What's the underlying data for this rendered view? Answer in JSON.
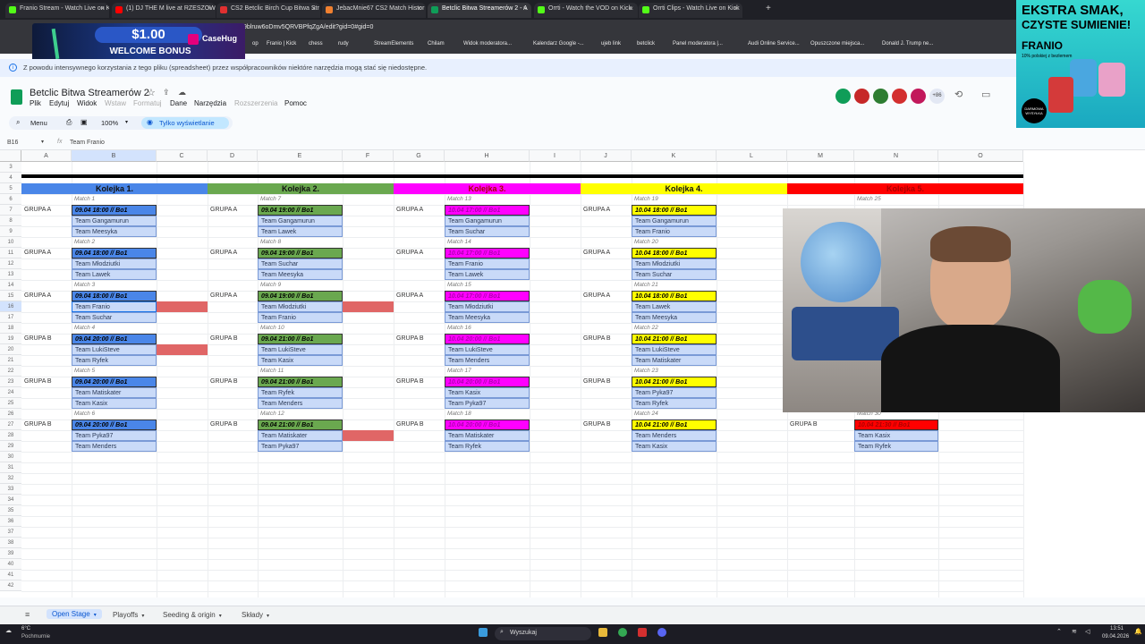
{
  "browser": {
    "tabs": [
      {
        "label": "Franio Stream - Watch Live on K",
        "fav": "#53fc18"
      },
      {
        "label": "(1) DJ THE M live at RZESZOW",
        "fav": "#ff0000"
      },
      {
        "label": "CS2 Betclic Birch Cup Bitwa Str",
        "fav": "#e03030"
      },
      {
        "label": "JebacMnie67 CS2 Match Histor",
        "fav": "#f08030"
      },
      {
        "label": "Betclic Bitwa Streamerów 2 - A",
        "fav": "#0f9d58"
      },
      {
        "label": "Orrti - Watch the VOD on Kick",
        "fav": "#53fc18"
      },
      {
        "label": "Orrti Clips - Watch Live on Kick",
        "fav": "#53fc18"
      }
    ],
    "address": "9blruw6oDmv5QRVBPfqZgA/edit?gid=0#gid=0",
    "bookmarks": [
      "op",
      "Franio | Kick",
      "chess",
      "rudy",
      "StreamElements",
      "Chilam",
      "Widok moderatora...",
      "Kalendarz Google -...",
      "ujeb link",
      "betclick",
      "Panel moderatora |...",
      "Audi Online Service...",
      "Opuszczone miejsca...",
      "Donald J. Trump ne..."
    ]
  },
  "ads": {
    "top_amount": "$1.00",
    "top_bonus": "WELCOME BONUS",
    "top_brand": "CaseHug",
    "right_line1": "EKSTRA SMAK,",
    "right_line2": "CZYSTE SUMIENIE!",
    "right_brand": "FRANIO",
    "right_small": "10% polskiej z bezlemem",
    "right_badge": "DARMOWA WYSYŁKA"
  },
  "banner": {
    "text": "Z powodu intensywnego korzystania z tego pliku (spreadsheet) przez współpracowników niektóre narzędzia mogą stać się niedostępne."
  },
  "doc": {
    "title": "Betclic Bitwa Streamerów 2",
    "menu": [
      "Plik",
      "Edytuj",
      "Widok",
      "Wstaw",
      "Formatuj",
      "Dane",
      "Narzędzia",
      "Rozszerzenia",
      "Pomoc"
    ],
    "toolbar": {
      "menu_label": "Menu",
      "zoom": "100%",
      "view_only": "Tylko wyświetlanie"
    },
    "collab_count": "+86",
    "name_box": "B16",
    "formula": "Team Franio"
  },
  "grid": {
    "columns": [
      "A",
      "B",
      "C",
      "D",
      "E",
      "F",
      "G",
      "H",
      "I",
      "J",
      "K",
      "L",
      "M",
      "N",
      "O"
    ],
    "rows": [
      "3",
      "4",
      "5",
      "6",
      "7",
      "8",
      "9",
      "10",
      "11",
      "12",
      "13",
      "14",
      "15",
      "16",
      "17",
      "18",
      "19",
      "20",
      "21",
      "22",
      "23",
      "24",
      "25",
      "26",
      "27",
      "28",
      "29",
      "30",
      "31",
      "32",
      "33",
      "34",
      "35",
      "36",
      "37",
      "38",
      "39",
      "40",
      "41",
      "42"
    ],
    "rounds": [
      {
        "label": "Kolejka 1.",
        "color": "#4a86e8"
      },
      {
        "label": "Kolejka 2.",
        "color": "#6aa84f"
      },
      {
        "label": "Kolejka 3.",
        "color": "#ff00ff"
      },
      {
        "label": "Kolejka 4.",
        "color": "#ffff00"
      },
      {
        "label": "Kolejka 5.",
        "color": "#ff0000"
      }
    ],
    "groups": [
      "GRUPA A",
      "GRUPA A",
      "GRUPA A",
      "GRUPA B",
      "GRUPA B",
      "GRUPA B"
    ],
    "round1": [
      {
        "match": "Match 1",
        "time": "09.04 18:00  // Bo1",
        "t1": "Team Gangamurun",
        "t2": "Team Meesyka"
      },
      {
        "match": "Match 2",
        "time": "09.04 18:00  // Bo1",
        "t1": "Team Młodziutki",
        "t2": "Team Lawek"
      },
      {
        "match": "Match 3",
        "time": "09.04 18:00  // Bo1",
        "t1": "Team Franio",
        "t2": "Team Suchar"
      },
      {
        "match": "Match 4",
        "time": "09.04 20:00  // Bo1",
        "t1": "Team LukiSteve",
        "t2": "Team Ryfek"
      },
      {
        "match": "Match 5",
        "time": "09.04 20:00  // Bo1",
        "t1": "Team Matiskater",
        "t2": "Team Kasix"
      },
      {
        "match": "Match 6",
        "time": "09.04 20:00  // Bo1",
        "t1": "Team Pyka97",
        "t2": "Team Menders"
      }
    ],
    "round2": [
      {
        "match": "Match 7",
        "time": "09.04 19:00  // Bo1",
        "t1": "Team Gangamurun",
        "t2": "Team Lawek"
      },
      {
        "match": "Match 8",
        "time": "09.04 19:00  // Bo1",
        "t1": "Team Suchar",
        "t2": "Team Meesyka"
      },
      {
        "match": "Match 9",
        "time": "09.04 19:00  // Bo1",
        "t1": "Team Młodziutki",
        "t2": "Team Franio"
      },
      {
        "match": "Match 10",
        "time": "09.04 21:00  // Bo1",
        "t1": "Team LukiSteve",
        "t2": "Team Kasix"
      },
      {
        "match": "Match 11",
        "time": "09.04 21:00  // Bo1",
        "t1": "Team Ryfek",
        "t2": "Team Menders"
      },
      {
        "match": "Match 12",
        "time": "09.04 21:00  // Bo1",
        "t1": "Team Matiskater",
        "t2": "Team Pyka97"
      }
    ],
    "round3": [
      {
        "match": "Match 13",
        "time": "10.04 17:00  // Bo1",
        "t1": "Team Gangamurun",
        "t2": "Team Suchar"
      },
      {
        "match": "Match 14",
        "time": "10.04 17:00  // Bo1",
        "t1": "Team Franio",
        "t2": "Team Lawek"
      },
      {
        "match": "Match 15",
        "time": "10.04 17:00  // Bo1",
        "t1": "Team Młodziutki",
        "t2": "Team Meesyka"
      },
      {
        "match": "Match 16",
        "time": "10.04 20:00  // Bo1",
        "t1": "Team LukiSteve",
        "t2": "Team Menders"
      },
      {
        "match": "Match 17",
        "time": "10.04 20:00  // Bo1",
        "t1": "Team Kasix",
        "t2": "Team Pyka97"
      },
      {
        "match": "Match 18",
        "time": "10.04 20:00  // Bo1",
        "t1": "Team Matiskater",
        "t2": "Team Ryfek"
      }
    ],
    "round4": [
      {
        "match": "Match 19",
        "time": "10.04 18:00  // Bo1",
        "t1": "Team Gangamurun",
        "t2": "Team Franio"
      },
      {
        "match": "Match 20",
        "time": "10.04 18:00  // Bo1",
        "t1": "Team Młodziutki",
        "t2": "Team Suchar"
      },
      {
        "match": "Match 21",
        "time": "10.04 18:00  // Bo1",
        "t1": "Team Lawek",
        "t2": "Team Meesyka"
      },
      {
        "match": "Match 22",
        "time": "10.04 21:00  // Bo1",
        "t1": "Team LukiSteve",
        "t2": "Team Matiskater"
      },
      {
        "match": "Match 23",
        "time": "10.04 21:00  // Bo1",
        "t1": "Team Pyka97",
        "t2": "Team Ryfek"
      },
      {
        "match": "Match 24",
        "time": "10.04 21:00  // Bo1",
        "t1": "Team Menders",
        "t2": "Team Kasix"
      }
    ],
    "round5": [
      {
        "match": "Match 25"
      },
      {
        "match": "Match 30",
        "time": "10.04 21:30  // Bo1",
        "t1": "Team Kasix",
        "t2": "Team Ryfek",
        "group": "GRUPA B"
      }
    ]
  },
  "sheet_tabs": [
    "Open Stage",
    "Playoffs",
    "Seeding & origin",
    "Składy"
  ],
  "taskbar": {
    "weather_temp": "6°C",
    "weather_desc": "Pochmurnie",
    "search": "Wyszukaj",
    "time": "13:51",
    "date": "09.04.2026"
  }
}
